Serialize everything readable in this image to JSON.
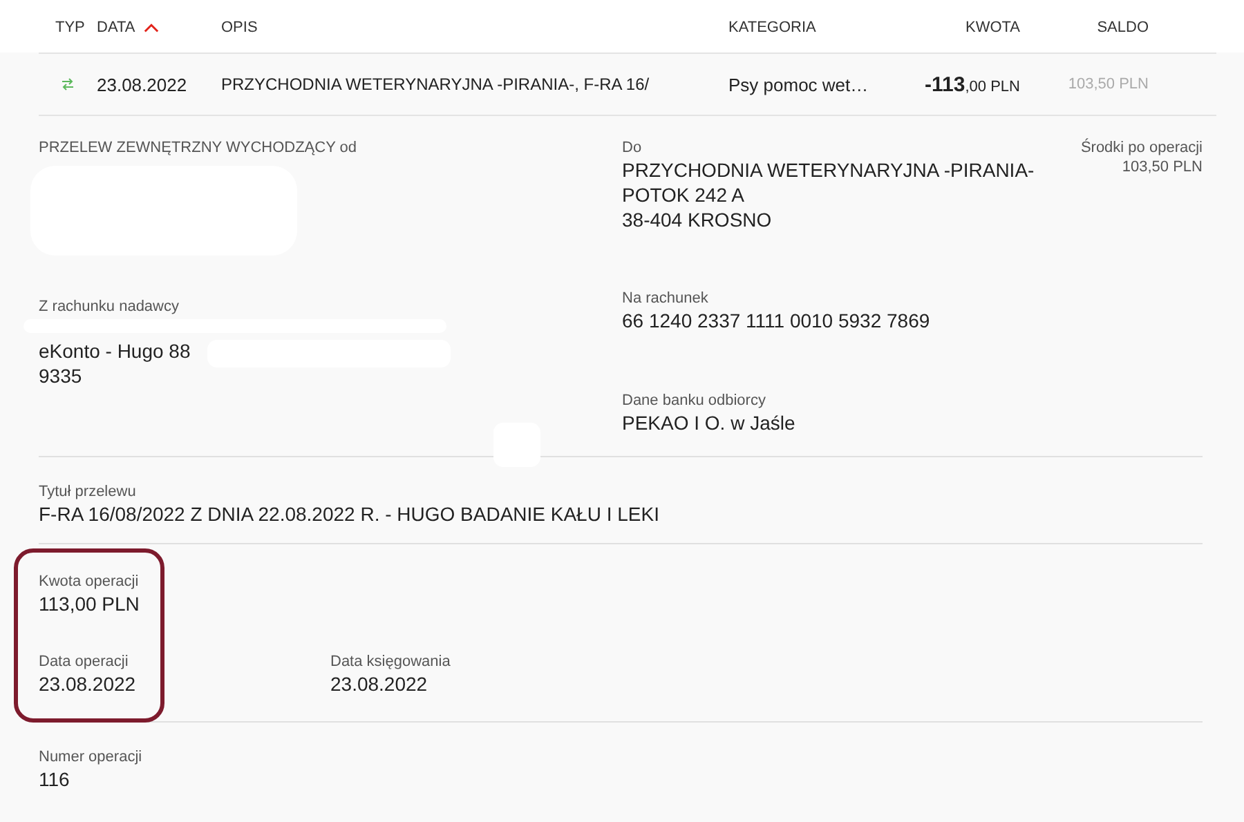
{
  "table": {
    "columns": [
      {
        "label": "TYP",
        "sorted": false
      },
      {
        "label": "DATA",
        "sorted": true
      },
      {
        "label": "OPIS",
        "sorted": false
      },
      {
        "label": "KATEGORIA",
        "sorted": false
      },
      {
        "label": "KWOTA",
        "sorted": false
      },
      {
        "label": "SALDO",
        "sorted": false
      }
    ],
    "rows": [
      {
        "kind": "transfer",
        "date": "23.08.2022",
        "description": "PRZYCHODNIA WETERYNARYJNA -PIRANIA-, F-RA 16/",
        "category": "Psy pomoc wet…",
        "amount": "**-113**,00 PLN",
        "balance": "103,50 PLN"
      }
    ]
  },
  "details": {
    "highlight_frame": true,
    "header": "PRZELEW ZEWNĘTRZNY WYCHODZĄCY od",
    "balance_after": {
      "label": "Środki po operacji",
      "value": "103,50 PLN"
    },
    "sender_account": {
      "label": "Z rachunku nadawcy",
      "lines": [
        "eKonto - Hugo 88",
        "9335"
      ]
    },
    "recipient": {
      "label": "Do",
      "lines": [
        "PRZYCHODNIA WETERYNARYJNA -PIRANIA-",
        "POTOK 242 A",
        "38-404 KROSNO"
      ]
    },
    "recipient_account": {
      "label": "Na rachunek",
      "value": "66 1240 2337 1111 0010 5932 7869"
    },
    "recipient_bank": {
      "label": "Dane banku odbiorcy",
      "value": "PEKAO I O. w Jaśle"
    },
    "title": {
      "label": "Tytuł przelewu",
      "value": "F-RA 16/08/2022 Z DNIA 22.08.2022 R. - HUGO BADANIE KAŁU I LEKI"
    },
    "amount": {
      "label": "Kwota operacji",
      "value": "113,00 PLN"
    },
    "operation_date": {
      "label": "Data operacji",
      "value": "23.08.2022"
    },
    "booking_date": {
      "label": "Data księgowania",
      "value": "23.08.2022"
    },
    "operation_number": {
      "label": "Numer operacji",
      "value": "116"
    }
  }
}
